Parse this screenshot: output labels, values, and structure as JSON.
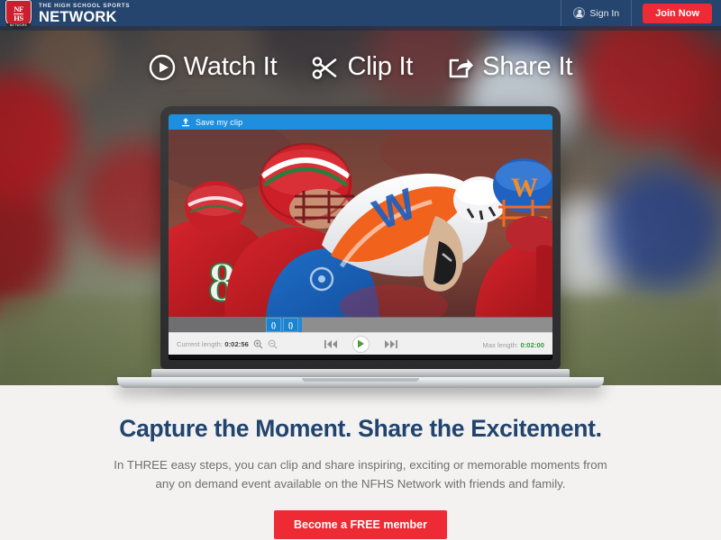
{
  "header": {
    "brand_kicker": "THE HIGH SCHOOL SPORTS",
    "brand_name": "NETWORK",
    "logo_line1": "NF",
    "logo_line2": "HS",
    "logo_footer": "NETWORK",
    "sign_in_label": "Sign In",
    "join_now_label": "Join Now",
    "bg_color": "#26456e",
    "accent_red": "#ee2b34"
  },
  "steps": [
    {
      "label": "Watch It",
      "icon": "play-circle-icon"
    },
    {
      "label": "Clip It",
      "icon": "scissors-icon"
    },
    {
      "label": "Share It",
      "icon": "share-box-icon"
    }
  ],
  "player": {
    "save_clip_label": "Save my clip",
    "save_bar_color": "#1e8ede",
    "current_length_label": "Current length:",
    "current_length_value": "0:02:56",
    "max_length_label": "Max length:",
    "max_length_value": "0:02:00",
    "max_length_color": "#2e9a3e",
    "zoom_in_icon": "magnifier-plus-icon",
    "zoom_out_icon": "magnifier-minus-icon",
    "skip_back_icon": "skip-back-icon",
    "play_icon": "play-icon",
    "skip_forward_icon": "skip-forward-icon",
    "clip_handle_left_glyph": "()",
    "clip_handle_right_glyph": "()",
    "video_description": "High school football tackle — red-jersey defenders tackling an orange-and-white jersey ball carrier"
  },
  "bottom": {
    "headline": "Capture the Moment. Share the Excitement.",
    "paragraph_line1": "In THREE easy steps, you can clip and share inspiring, exciting or memorable moments",
    "paragraph_line2": "from any on demand event available on the NFHS Network with friends and family.",
    "cta_label": "Become a FREE member",
    "headline_color": "#21446f",
    "bg_color": "#f3f2f1"
  }
}
